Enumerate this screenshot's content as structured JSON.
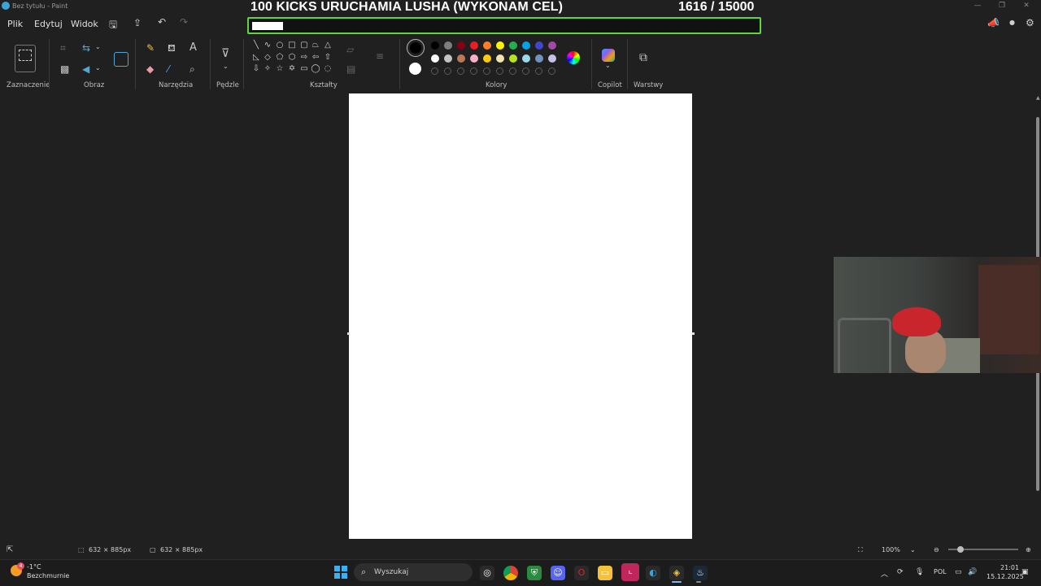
{
  "window": {
    "title": "Bez tytułu - Paint"
  },
  "overlay": {
    "goal_title": "100 KICKS URUCHAMIA LUSHA (WYKONAM CEL)",
    "goal_count": "1616   / 15000",
    "progress_fraction": 0.1077,
    "accent_color": "#5fd63e"
  },
  "menu": {
    "file": "Plik",
    "edit": "Edytuj",
    "view": "Widok"
  },
  "ribbon": {
    "selection": "Zaznaczenie",
    "image": "Obraz",
    "tools": "Narzędzia",
    "brushes": "Pędzle",
    "shapes": "Kształty",
    "colors": "Kolory",
    "copilot": "Copilot",
    "layers": "Warstwy"
  },
  "palette": {
    "row1": [
      "#000000",
      "#7f7f7f",
      "#880015",
      "#ed1c24",
      "#ff7f27",
      "#fff200",
      "#22b14c",
      "#00a2e8",
      "#3f48cc",
      "#a349a4"
    ],
    "row2": [
      "#ffffff",
      "#c3c3c3",
      "#b97a57",
      "#ffaec9",
      "#ffc90e",
      "#efe4b0",
      "#b5e61d",
      "#99d9ea",
      "#7092be",
      "#c8bfe7"
    ],
    "primary": "#000000",
    "secondary": "#ffffff"
  },
  "status": {
    "selection_size": "632 × 885px",
    "canvas_size": "632 × 885px",
    "zoom": "100%"
  },
  "taskbar": {
    "weather_temp": "-1°C",
    "weather_desc": "Bezchmurnie",
    "weather_badge": "4",
    "search_placeholder": "Wyszukaj",
    "language": "POL",
    "time": "21:01",
    "date": "15.12.2025"
  }
}
